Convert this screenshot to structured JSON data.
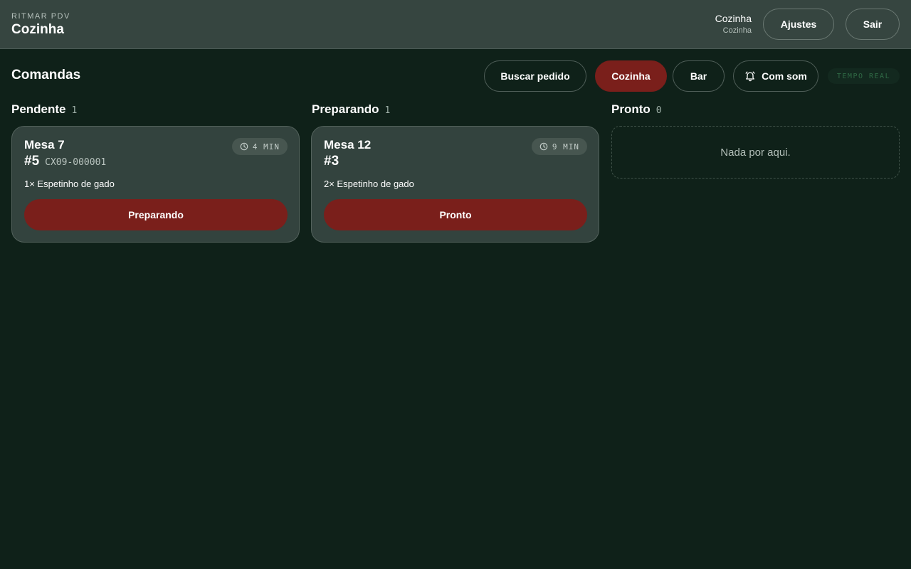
{
  "header": {
    "brand": "RITMAR PDV",
    "title": "Cozinha",
    "user_name": "Cozinha",
    "user_role": "Cozinha",
    "settings_label": "Ajustes",
    "logout_label": "Sair"
  },
  "toolbar": {
    "title": "Comandas",
    "search_label": "Buscar pedido",
    "filters": [
      {
        "label": "Cozinha",
        "active": true
      },
      {
        "label": "Bar",
        "active": false
      }
    ],
    "sound_label": "Com som",
    "sound_icon": "bell-icon",
    "realtime_label": "TEMPO REAL"
  },
  "columns": [
    {
      "title": "Pendente",
      "count": "1",
      "orders": [
        {
          "table": "Mesa 7",
          "number": "#5",
          "code": "CX09-000001",
          "time": "4 MIN",
          "items": "1× Espetinho de gado",
          "action": "Preparando"
        }
      ]
    },
    {
      "title": "Preparando",
      "count": "1",
      "orders": [
        {
          "table": "Mesa 12",
          "number": "#3",
          "code": "",
          "time": "9 MIN",
          "items": "2× Espetinho de gado",
          "action": "Pronto"
        }
      ]
    },
    {
      "title": "Pronto",
      "count": "0",
      "orders": [],
      "empty_text": "Nada por aqui."
    }
  ],
  "colors": {
    "background": "#0f2119",
    "header": "#364540",
    "accent": "#7a1f1b",
    "card": "#33433e"
  }
}
